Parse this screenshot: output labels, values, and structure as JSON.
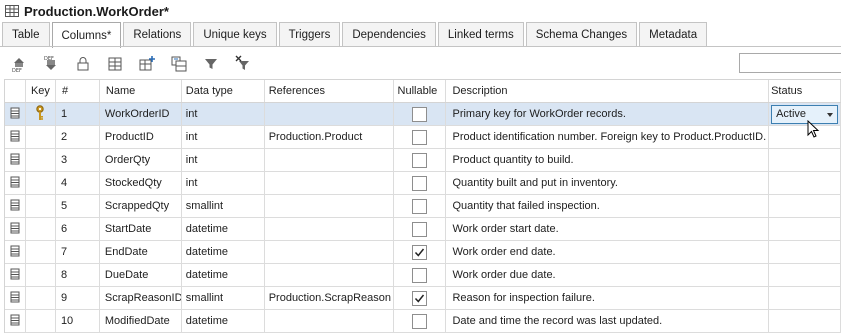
{
  "window": {
    "title": "Production.WorkOrder*"
  },
  "tabs": [
    {
      "label": "Table"
    },
    {
      "label": "Columns*"
    },
    {
      "label": "Relations"
    },
    {
      "label": "Unique keys"
    },
    {
      "label": "Triggers"
    },
    {
      "label": "Dependencies"
    },
    {
      "label": "Linked terms"
    },
    {
      "label": "Schema Changes"
    },
    {
      "label": "Metadata"
    }
  ],
  "active_tab": "Columns*",
  "toolbar": {
    "icons": [
      "add-column-icon",
      "add-default-icon",
      "lock-icon",
      "table-view-icon",
      "insert-row-icon",
      "copy-row-icon",
      "filter-icon",
      "clear-filter-icon"
    ],
    "search_value": ""
  },
  "grid": {
    "headers": {
      "key": "Key",
      "num": "#",
      "name": "Name",
      "type": "Data type",
      "ref": "References",
      "nullable": "Nullable",
      "desc": "Description",
      "status": "Status"
    },
    "rows": [
      {
        "num": "1",
        "name": "WorkOrderID",
        "type": "int",
        "ref": "",
        "nullable": false,
        "desc": "Primary key for WorkOrder records.",
        "status": "Active",
        "key": true
      },
      {
        "num": "2",
        "name": "ProductID",
        "type": "int",
        "ref": "Production.Product",
        "nullable": false,
        "desc": "Product identification number. Foreign key to Product.ProductID.",
        "status": "",
        "key": false
      },
      {
        "num": "3",
        "name": "OrderQty",
        "type": "int",
        "ref": "",
        "nullable": false,
        "desc": "Product quantity to build.",
        "status": "",
        "key": false
      },
      {
        "num": "4",
        "name": "StockedQty",
        "type": "int",
        "ref": "",
        "nullable": false,
        "desc": "Quantity built and put in inventory.",
        "status": "",
        "key": false
      },
      {
        "num": "5",
        "name": "ScrappedQty",
        "type": "smallint",
        "ref": "",
        "nullable": false,
        "desc": "Quantity that failed inspection.",
        "status": "",
        "key": false
      },
      {
        "num": "6",
        "name": "StartDate",
        "type": "datetime",
        "ref": "",
        "nullable": false,
        "desc": "Work order start date.",
        "status": "",
        "key": false
      },
      {
        "num": "7",
        "name": "EndDate",
        "type": "datetime",
        "ref": "",
        "nullable": true,
        "desc": "Work order end date.",
        "status": "",
        "key": false
      },
      {
        "num": "8",
        "name": "DueDate",
        "type": "datetime",
        "ref": "",
        "nullable": false,
        "desc": "Work order due date.",
        "status": "",
        "key": false
      },
      {
        "num": "9",
        "name": "ScrapReasonID",
        "type": "smallint",
        "ref": "Production.ScrapReason",
        "nullable": true,
        "desc": "Reason for inspection failure.",
        "status": "",
        "key": false
      },
      {
        "num": "10",
        "name": "ModifiedDate",
        "type": "datetime",
        "ref": "",
        "nullable": false,
        "desc": "Date and time the record was last updated.",
        "status": "",
        "key": false
      }
    ]
  },
  "colors": {
    "selected_row": "#d9e5f3",
    "dropdown_border": "#3c7fb1",
    "key_icon": "#c8961e"
  }
}
